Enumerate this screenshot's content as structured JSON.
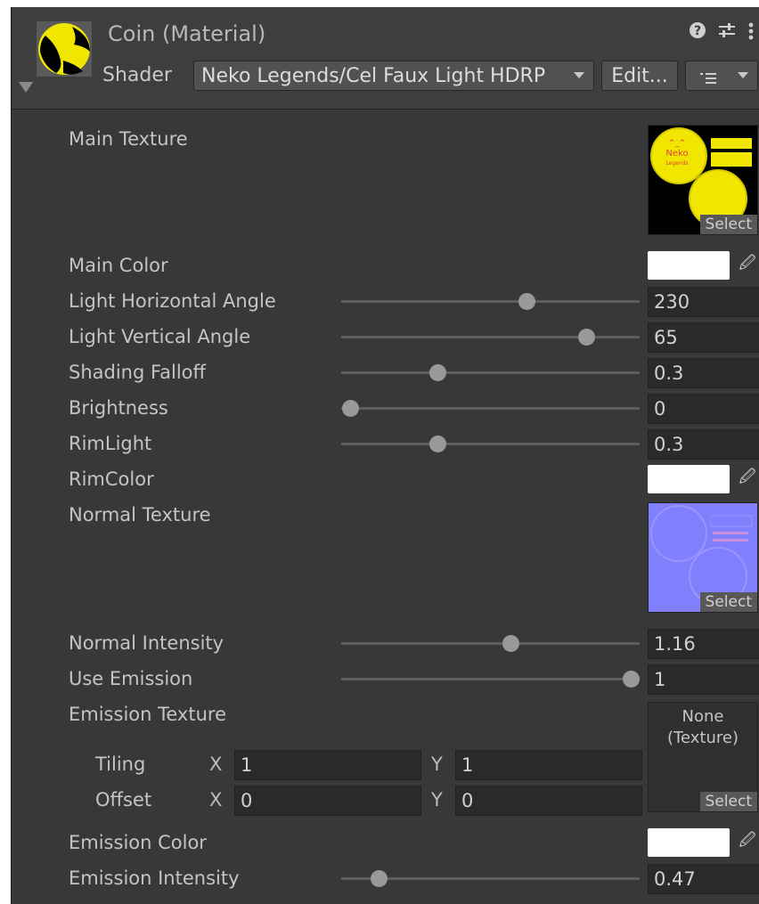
{
  "header": {
    "title": "Coin (Material)",
    "shader_label": "Shader",
    "shader_value": "Neko Legends/Cel Faux Light HDRP",
    "edit_label": "Edit...",
    "help_icon": "help-icon",
    "presets_icon": "sliders-icon",
    "menu_icon": "kebab-menu-icon",
    "list_icon": "list-icon"
  },
  "properties": {
    "main_texture": {
      "label": "Main Texture",
      "select": "Select",
      "logo_text": "Neko",
      "logo_face": "^_^",
      "logo_sub": "Legends"
    },
    "main_color": {
      "label": "Main Color",
      "color": "#ffffff"
    },
    "light_h": {
      "label": "Light Horizontal Angle",
      "value": "230",
      "fraction": 0.63
    },
    "light_v": {
      "label": "Light Vertical Angle",
      "value": "65",
      "fraction": 0.84
    },
    "shading": {
      "label": "Shading Falloff",
      "value": "0.3",
      "fraction": 0.31
    },
    "brightness": {
      "label": "Brightness",
      "value": "0",
      "fraction": 0.0
    },
    "rimlight": {
      "label": "RimLight",
      "value": "0.3",
      "fraction": 0.31
    },
    "rimcolor": {
      "label": "RimColor",
      "color": "#ffffff"
    },
    "normal_texture": {
      "label": "Normal Texture",
      "select": "Select"
    },
    "normal_intensity": {
      "label": "Normal Intensity",
      "value": "1.16",
      "fraction": 0.57
    },
    "use_emission": {
      "label": "Use Emission",
      "value": "1",
      "fraction": 1.0
    },
    "emission_texture": {
      "label": "Emission Texture",
      "none_text": "None\n(Texture)",
      "select": "Select",
      "tiling_label": "Tiling",
      "offset_label": "Offset",
      "x_label": "X",
      "y_label": "Y",
      "tiling_x": "1",
      "tiling_y": "1",
      "offset_x": "0",
      "offset_y": "0"
    },
    "emission_color": {
      "label": "Emission Color",
      "color": "#ffffff"
    },
    "emission_intensity": {
      "label": "Emission Intensity",
      "value": "0.47",
      "fraction": 0.1
    }
  },
  "colors": {
    "panel": "#383838",
    "header": "#3e3e3e",
    "coin_yellow": "#f0e600",
    "normal_blue": "#8080ff"
  }
}
